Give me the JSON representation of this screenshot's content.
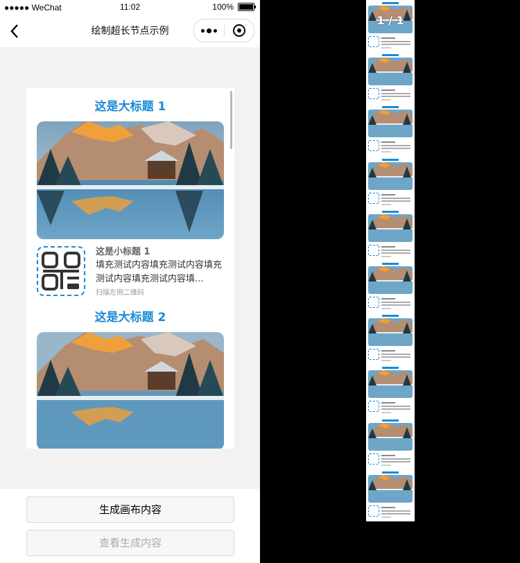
{
  "status_bar": {
    "carrier": "●●●●● WeChat",
    "time": "11:02",
    "battery": "100%"
  },
  "nav": {
    "title": "绘制超长节点示例"
  },
  "cards": [
    {
      "title": "这是大标题 1",
      "subtitle": "这是小标题 1",
      "desc": "填充测试内容填充测试内容填充测试内容填充测试内容填...",
      "hint": "扫描左侧二维码"
    },
    {
      "title": "这是大标题 2"
    }
  ],
  "buttons": {
    "generate": "生成画布内容",
    "view": "查看生成内容"
  },
  "preview": {
    "page_indicator": "1 / 1"
  },
  "colors": {
    "accent": "#1a8ad6",
    "page_bg": "#f2f2f2",
    "preview_bg": "#000000"
  }
}
